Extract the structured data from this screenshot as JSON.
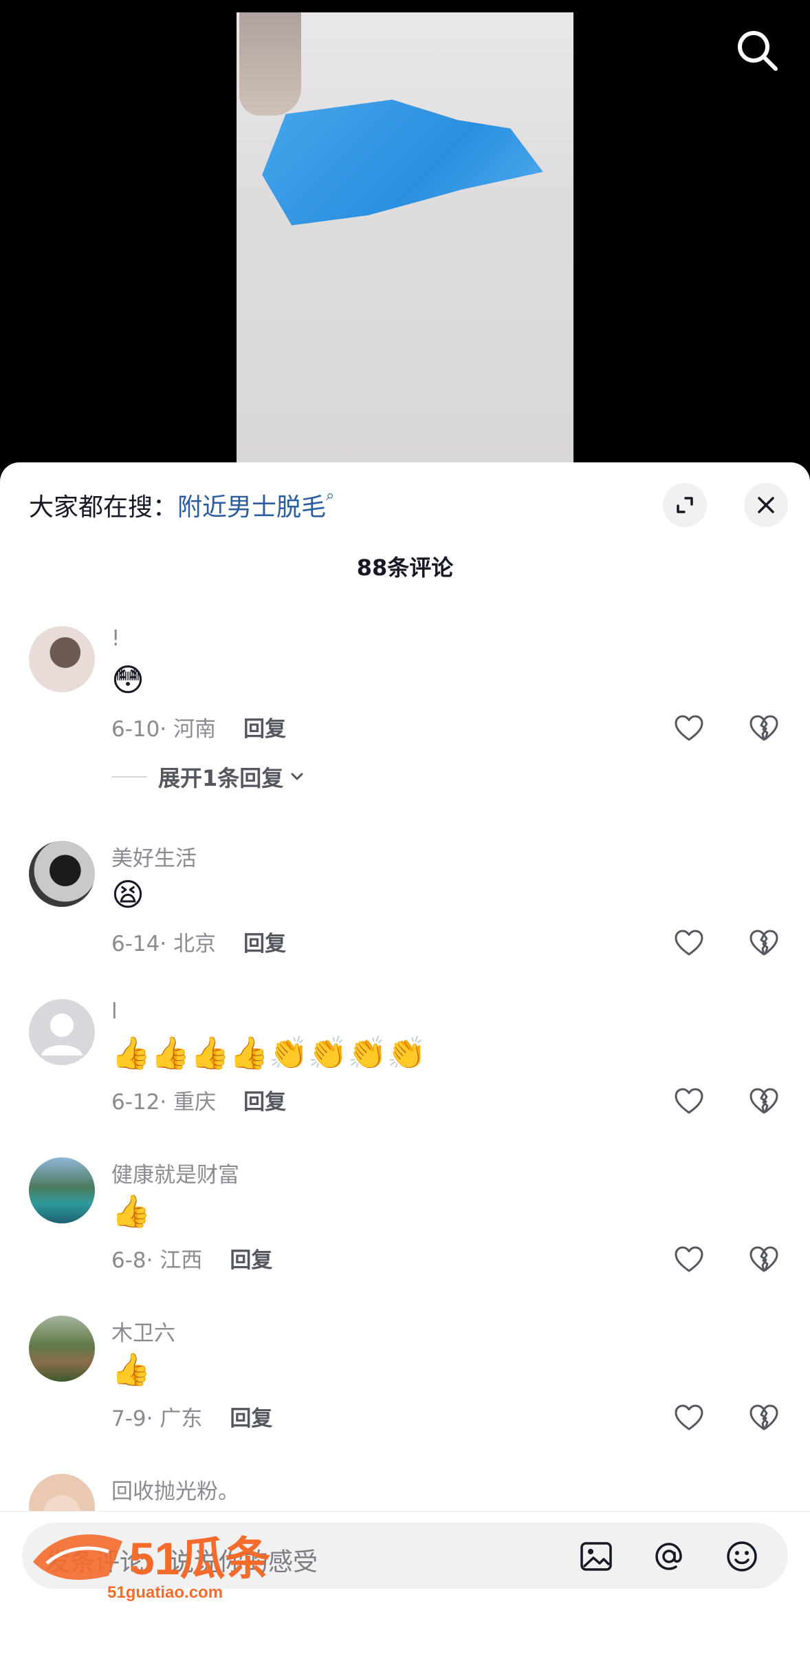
{
  "header": {
    "search_icon": "search-icon"
  },
  "sheet": {
    "trend_prefix": "大家都在搜：",
    "trend_keyword": "附近男士脱毛",
    "comment_count": "88条评论",
    "expand_icon": "expand-icon",
    "close_icon": "close-icon"
  },
  "comments": [
    {
      "user": "!",
      "content": "😳",
      "date": "6-10",
      "location": "河南",
      "reply_label": "回复",
      "expand_replies": "展开1条回复"
    },
    {
      "user": "美好生活",
      "content": "😫",
      "date": "6-14",
      "location": "北京",
      "reply_label": "回复"
    },
    {
      "user": "l",
      "content": "👍👍👍👍👏👏👏👏",
      "date": "6-12",
      "location": "重庆",
      "reply_label": "回复"
    },
    {
      "user": "健康就是财富",
      "content": "👍",
      "date": "6-8",
      "location": "江西",
      "reply_label": "回复"
    },
    {
      "user": "木卫六",
      "content": "👍",
      "date": "7-9",
      "location": "广东",
      "reply_label": "回复"
    },
    {
      "user": "回收抛光粉。"
    }
  ],
  "composer": {
    "placeholder": "发条评论，说说你的感受",
    "icons": [
      "image-icon",
      "at-icon",
      "emoji-icon"
    ]
  },
  "watermark": {
    "brand": "51瓜条",
    "url": "51guatiao.com"
  }
}
